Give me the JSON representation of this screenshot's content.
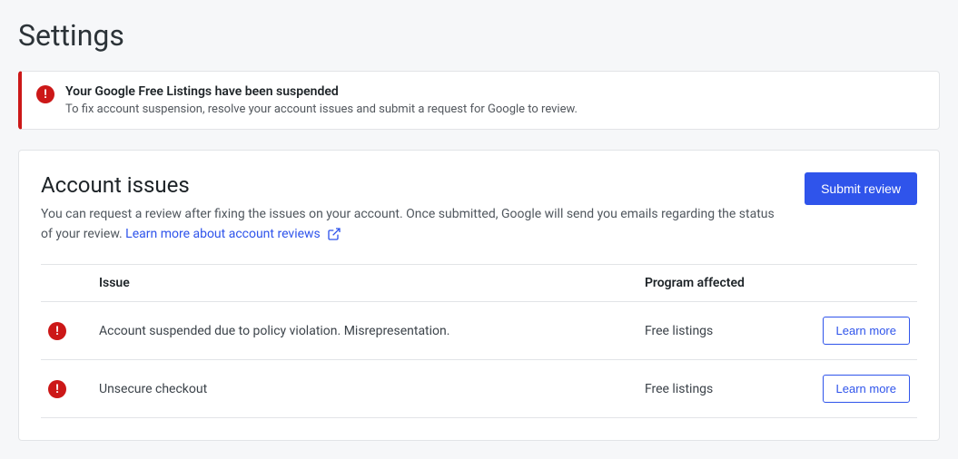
{
  "page_title": "Settings",
  "alert": {
    "title": "Your Google Free Listings have been suspended",
    "description": "To fix account suspension, resolve your account issues and submit a request for Google to review."
  },
  "panel": {
    "title": "Account issues",
    "description_before_link": "You can request a review after fixing the issues on your account. Once submitted, Google will send you emails regarding the status of your review. ",
    "link_text": "Learn more about account reviews",
    "submit_button": "Submit review"
  },
  "table": {
    "headers": {
      "issue": "Issue",
      "program": "Program affected"
    },
    "rows": [
      {
        "issue": "Account suspended due to policy violation. Misrepresentation.",
        "program": "Free listings",
        "action": "Learn more"
      },
      {
        "issue": "Unsecure checkout",
        "program": "Free listings",
        "action": "Learn more"
      }
    ]
  }
}
